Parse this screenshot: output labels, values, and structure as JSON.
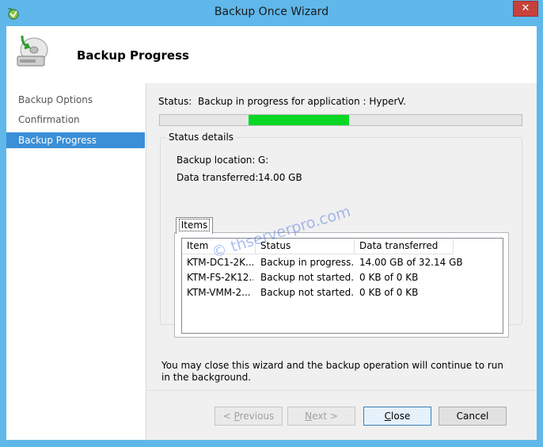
{
  "window": {
    "title": "Backup Once Wizard",
    "close_glyph": "✕",
    "icon": "backup-app-icon"
  },
  "header": {
    "title": "Backup Progress",
    "icon": "backup-drive-icon"
  },
  "nav": {
    "items": [
      {
        "label": "Backup Options",
        "active": false
      },
      {
        "label": "Confirmation",
        "active": false
      },
      {
        "label": "Backup Progress",
        "active": true
      }
    ]
  },
  "status": {
    "label": "Status:",
    "text": "Backup in progress for application : HyperV.",
    "progress_indicator": "marquee segment (indeterminate)"
  },
  "details": {
    "legend": "Status details",
    "backup_location_label": "Backup location:",
    "backup_location_value": "G:",
    "data_transferred_label": "Data transferred:",
    "data_transferred_value": "14.00 GB"
  },
  "items_tab": {
    "label": "Items",
    "columns": [
      "Item",
      "Status",
      "Data transferred"
    ],
    "rows": [
      {
        "item": "KTM-DC1-2K...",
        "status": "Backup in progress...",
        "transferred": "14.00 GB of 32.14 GB"
      },
      {
        "item": "KTM-FS-2K12...",
        "status": "Backup not started.",
        "transferred": "0 KB of 0 KB"
      },
      {
        "item": "KTM-VMM-2...",
        "status": "Backup not started.",
        "transferred": "0 KB of 0 KB"
      }
    ]
  },
  "note": "You may close this wizard and the backup operation will continue to run in the background.",
  "watermark": "© thserverpro.com",
  "buttons": {
    "previous": {
      "pre": "< ",
      "key": "P",
      "post": "revious"
    },
    "next": {
      "key": "N",
      "post": "ext >"
    },
    "close": {
      "key": "C",
      "post": "lose"
    },
    "cancel": "Cancel"
  },
  "colors": {
    "titlebar": "#5fb7ea",
    "nav_active": "#3b8fd6",
    "progress": "#06d825",
    "close_button": "#c7413c"
  }
}
